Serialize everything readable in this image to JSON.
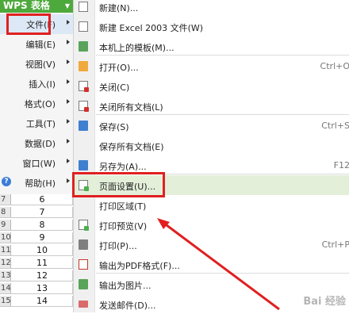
{
  "app": {
    "title": "WPS 表格"
  },
  "main_menu": [
    {
      "label": "文件(F)",
      "active": true
    },
    {
      "label": "编辑(E)"
    },
    {
      "label": "视图(V)"
    },
    {
      "label": "插入(I)"
    },
    {
      "label": "格式(O)"
    },
    {
      "label": "工具(T)"
    },
    {
      "label": "数据(D)"
    },
    {
      "label": "窗口(W)"
    },
    {
      "label": "帮助(H)"
    }
  ],
  "file_menu": [
    {
      "label": "新建(N)...",
      "shortcut": "",
      "icon": "new-doc-icon"
    },
    {
      "label": "新建 Excel 2003 文件(W)",
      "shortcut": "",
      "icon": "new-excel-icon"
    },
    {
      "label": "本机上的模板(M)...",
      "shortcut": "",
      "icon": "template-icon"
    },
    {
      "label": "打开(O)...",
      "shortcut": "Ctrl+O",
      "icon": "open-folder-icon"
    },
    {
      "label": "关闭(C)",
      "shortcut": "",
      "icon": "close-doc-icon"
    },
    {
      "label": "关闭所有文档(L)",
      "shortcut": "",
      "icon": "close-all-icon"
    },
    {
      "label": "保存(S)",
      "shortcut": "Ctrl+S",
      "icon": "save-icon"
    },
    {
      "label": "保存所有文档(E)",
      "shortcut": "",
      "icon": ""
    },
    {
      "label": "另存为(A)...",
      "shortcut": "F12",
      "icon": "save-as-icon"
    },
    {
      "label": "页面设置(U)...",
      "shortcut": "",
      "icon": "page-setup-icon",
      "highlight": true
    },
    {
      "label": "打印区域(T)",
      "shortcut": "",
      "icon": ""
    },
    {
      "label": "打印预览(V)",
      "shortcut": "",
      "icon": "print-preview-icon"
    },
    {
      "label": "打印(P)...",
      "shortcut": "Ctrl+P",
      "icon": "print-icon"
    },
    {
      "label": "输出为PDF格式(F)...",
      "shortcut": "",
      "icon": "pdf-icon"
    },
    {
      "label": "输出为图片...",
      "shortcut": "",
      "icon": "export-image-icon"
    },
    {
      "label": "发送邮件(D)...",
      "shortcut": "",
      "icon": "mail-icon"
    }
  ],
  "grid_rows": [
    {
      "row": "7",
      "value": "6"
    },
    {
      "row": "8",
      "value": "7"
    },
    {
      "row": "9",
      "value": "8"
    },
    {
      "row": "10",
      "value": "9"
    },
    {
      "row": "11",
      "value": "10"
    },
    {
      "row": "12",
      "value": "11"
    },
    {
      "row": "13",
      "value": "12"
    },
    {
      "row": "14",
      "value": "13"
    },
    {
      "row": "15",
      "value": "14"
    }
  ],
  "watermark": "Bai 经验",
  "colors": {
    "brand_green": "#4ea93c",
    "annotation_red": "#e02020",
    "highlight_green": "#e3efd9"
  }
}
